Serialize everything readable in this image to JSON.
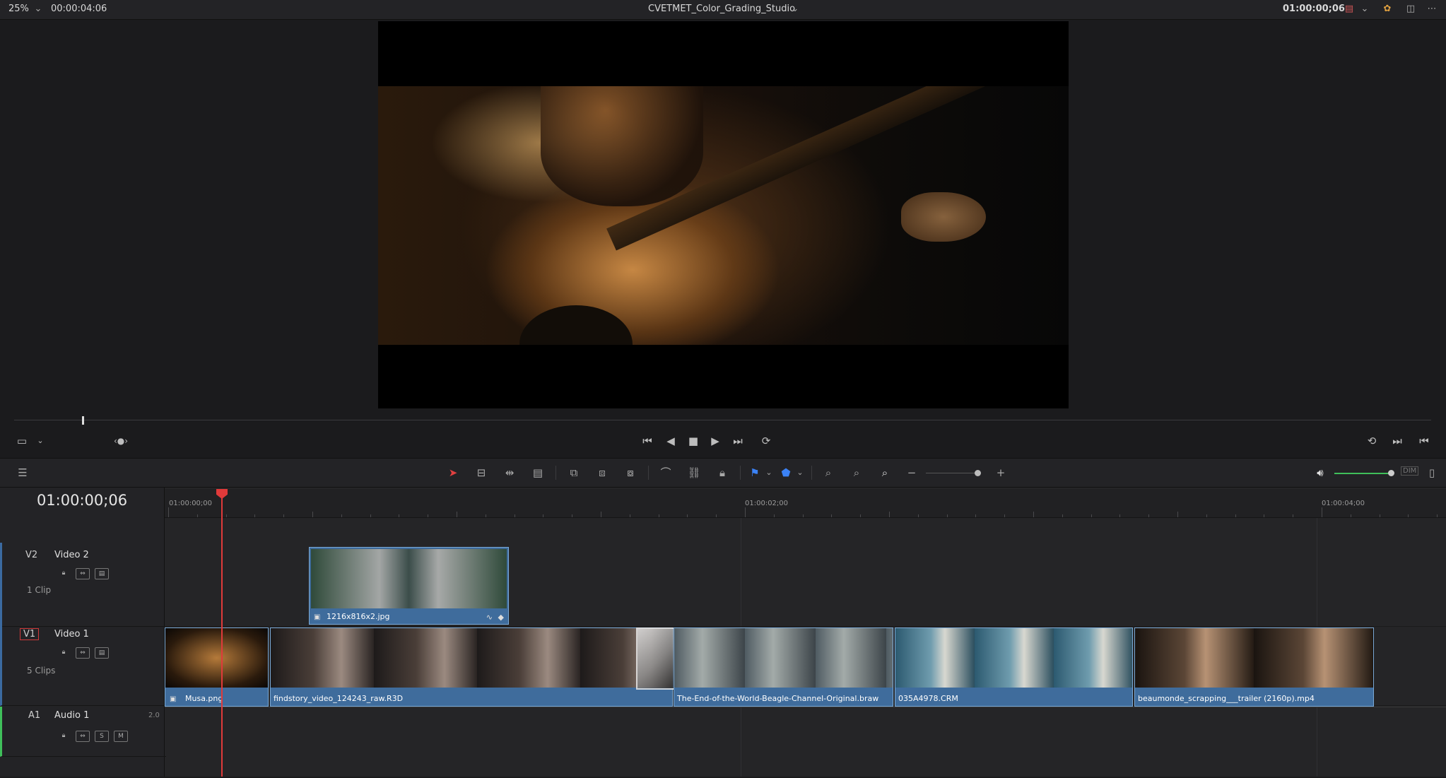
{
  "topbar": {
    "zoom": "25%",
    "source_timecode": "00:00:04:06",
    "project_title": "CVETMET_Color_Grading_Studio",
    "record_timecode": "01:00:00;06"
  },
  "viewer": {
    "image_icon": "viewer-frame-image",
    "scrubber_position": 0.045
  },
  "transport": {
    "icons": [
      "go-to-start-icon",
      "step-back-icon",
      "stop-icon",
      "play-icon",
      "go-to-end-icon",
      "loop-icon"
    ]
  },
  "timeline": {
    "timecode": "01:00:00;06",
    "ruler_labels": [
      "01:00:00;00",
      "01:00:02;00",
      "01:00:04;00"
    ],
    "tracks": [
      {
        "id": "V2",
        "name": "Video 2",
        "count": "1 Clip"
      },
      {
        "id": "V1",
        "name": "Video 1",
        "count": "5 Clips"
      },
      {
        "id": "A1",
        "name": "Audio 1",
        "channels": "2.0",
        "solo": "S",
        "mute": "M"
      }
    ],
    "clips_v2": [
      {
        "label": "1216x816x2.jpg"
      }
    ],
    "clips_v1": [
      {
        "label": "Musa.png"
      },
      {
        "label": "findstory_video_124243_raw.R3D"
      },
      {
        "label": "The-End-of-the-World-Beagle-Channel-Original.braw"
      },
      {
        "label": "035A4978.CRM"
      },
      {
        "label": "beaumonde_scrapping___trailer (2160p).mp4"
      }
    ],
    "audio_level": "DIM"
  },
  "colors": {
    "clip_blue": "#3f6c9c",
    "playhead_red": "#e03a3a",
    "volume_green": "#3fbf5a"
  }
}
